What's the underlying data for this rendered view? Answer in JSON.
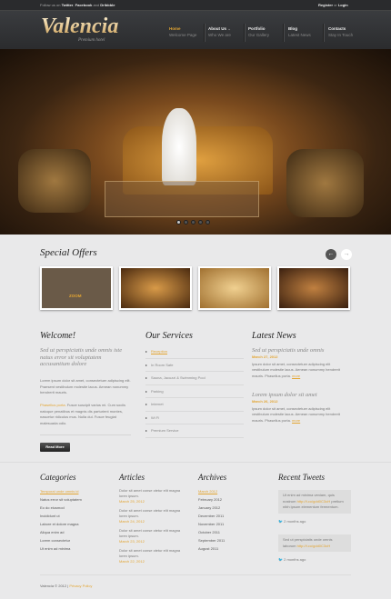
{
  "topbar": {
    "follow_prefix": "Follow us on",
    "twitter": "Twitter",
    "facebook": "Facebook",
    "and": "and",
    "dribbble": "Dribbble",
    "register": "Register",
    "or": "or",
    "login": "Login"
  },
  "brand": {
    "logo": "Valencia",
    "tagline": "Premium hotel"
  },
  "nav": [
    {
      "label": "Home",
      "sub": "Welcome Page"
    },
    {
      "label": "About Us",
      "sub": "Who We are"
    },
    {
      "label": "Portfolio",
      "sub": "Our Gallery"
    },
    {
      "label": "Blog",
      "sub": "Latest News"
    },
    {
      "label": "Contacts",
      "sub": "Stay In Touch"
    }
  ],
  "offers": {
    "title": "Special Offers",
    "zoom_label": "ZOOM",
    "prev": "←",
    "next": "→"
  },
  "welcome": {
    "title": "Welcome!",
    "subtitle": "Sed ut perspiciatis unde omnis iste natus error sit voluptatem accusantium dolore",
    "p1": "Lorem ipsum dolor sit amet, consectetuer adipiscing elit. Praesent vestibulum molestie lacus. Aenean nonummy hendrerit mauris.",
    "p2_link": "Phasellus porta.",
    "p2": " Fusce suscipit varius mi. Cum sociis natoque penatibus et magnis dis parturient montes, nascetur ridiculus mus. Nulla dui. Fusce feugiat malesuada odio.",
    "read_more": "Read More"
  },
  "services": {
    "title": "Our Services",
    "items": [
      "Reception",
      "In Room Safe",
      "Sauna, Jacuzzi & Swimming Pool",
      "Parking",
      "Internet",
      "Wi Fi",
      "Premium Service"
    ]
  },
  "news": {
    "title": "Latest News",
    "items": [
      {
        "title": "Sed ut perspiciatis unde omnis",
        "date": "March 27, 2012",
        "text": "Ipsum dolor sit amet, consectetuer adipiscing elit vestibulum molestie lacus. Aenean nonummy hendrerit mauris. Phasellus porta.",
        "more": "more"
      },
      {
        "title": "Lorem ipsum dolor sit amet",
        "date": "March 26, 2012",
        "text": "Ipsum dolor sit amet, consectetuer adipiscing elit vestibulum molestie lacus. Aenean nonummy hendrerit mauris. Phasellus porta.",
        "more": "more"
      }
    ]
  },
  "categories": {
    "title": "Categories",
    "items": [
      "Temporal unde omnis id",
      "Natus error sit voluptatem",
      "Eo do eiusmod",
      "Incididunt ut",
      "Labore et dolore magna",
      "Aliqua enim ad",
      "Lorem consectetur",
      "Ut enim ad minima"
    ]
  },
  "articles": {
    "title": "Articles",
    "items": [
      {
        "text": "Dolor sit amet conse ctetur elit magna loren ipsum.",
        "date": "March 25, 2012"
      },
      {
        "text": "Dolor sit amet conse ctetur elit magna loren ipsum.",
        "date": "March 24, 2012"
      },
      {
        "text": "Dolor sit amet conse ctetur elit magna loren ipsum.",
        "date": "March 23, 2012"
      },
      {
        "text": "Dolor sit amet conse ctetur elit magna loren ipsum.",
        "date": "March 22, 2012"
      }
    ]
  },
  "archives": {
    "title": "Archives",
    "items": [
      "March 2012",
      "February 2012",
      "January 2012",
      "December 2011",
      "November 2011",
      "October 2011",
      "September 2011",
      "August 2011"
    ]
  },
  "tweets": {
    "title": "Recent Tweets",
    "items": [
      {
        "text": "Ut enim ad minima veniam, quis nostrum ",
        "link": "http://t.co/gdd0C3oH",
        "text2": " pretium nibh ipsum elementum fermentum.",
        "time": "2 months ago"
      },
      {
        "text": "Sed ut perspiciatis unde omnis laborum ",
        "link": "http://t.co/gdd0C3oH",
        "text2": "",
        "time": "2 months ago"
      }
    ]
  },
  "footer": {
    "copyright": "Valencia © 2012",
    "sep": "|",
    "privacy": "Privacy Policy"
  },
  "colors": {
    "accent": "#e3a532",
    "header": "#2b2c2e",
    "background": "#e9e9ea"
  }
}
